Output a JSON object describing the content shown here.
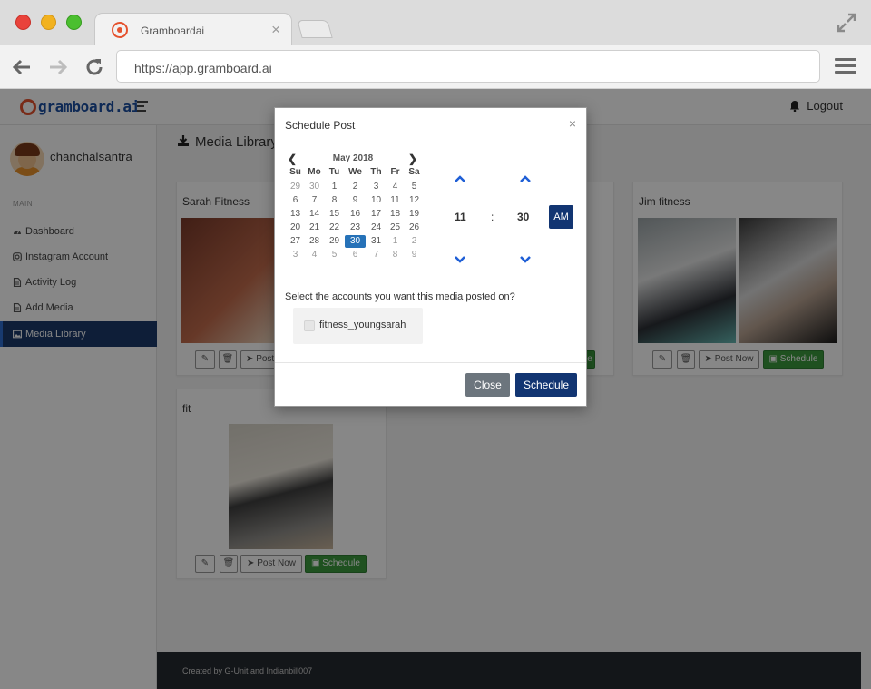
{
  "browser": {
    "tab_title": "Gramboardai",
    "url": "https://app.gramboard.ai"
  },
  "app": {
    "brand": "gramboard.ai",
    "logout_label": "Logout",
    "user": {
      "name": "chanchalsantra"
    },
    "sidebar": {
      "section_label": "MAIN",
      "items": [
        {
          "label": "Dashboard",
          "icon": "dashboard-icon"
        },
        {
          "label": "Instagram Account",
          "icon": "instagram-icon"
        },
        {
          "label": "Activity Log",
          "icon": "file-icon"
        },
        {
          "label": "Add Media",
          "icon": "file-icon"
        },
        {
          "label": "Media Library",
          "icon": "image-icon",
          "active": true
        }
      ]
    },
    "page_title": "Media Library",
    "cards": [
      {
        "title": "Sarah Fitness"
      },
      {
        "title": "Jim fitness"
      },
      {
        "title": "fit"
      }
    ],
    "card_actions": {
      "post_now": "Post Now",
      "schedule": "Schedule"
    },
    "footer": "Created by G-Unit and Indianbill007"
  },
  "modal": {
    "title": "Schedule Post",
    "close_x": "×",
    "calendar": {
      "month_label": "May 2018",
      "weekdays": [
        "Su",
        "Mo",
        "Tu",
        "We",
        "Th",
        "Fr",
        "Sa"
      ],
      "weeks": [
        [
          "29",
          "30",
          "1",
          "2",
          "3",
          "4",
          "5"
        ],
        [
          "6",
          "7",
          "8",
          "9",
          "10",
          "11",
          "12"
        ],
        [
          "13",
          "14",
          "15",
          "16",
          "17",
          "18",
          "19"
        ],
        [
          "20",
          "21",
          "22",
          "23",
          "24",
          "25",
          "26"
        ],
        [
          "27",
          "28",
          "29",
          "30",
          "31",
          "1",
          "2"
        ],
        [
          "3",
          "4",
          "5",
          "6",
          "7",
          "8",
          "9"
        ]
      ],
      "selected_day": "30"
    },
    "time": {
      "hour": "11",
      "separator": ":",
      "minute": "30",
      "meridiem": "AM"
    },
    "accounts_prompt": "Select the accounts you want this media posted on?",
    "accounts": [
      {
        "name": "fitness_youngsarah",
        "checked": false
      }
    ],
    "close_label": "Close",
    "schedule_label": "Schedule"
  },
  "colors": {
    "primary": "#123572",
    "sidebar_active": "#1b3a6b",
    "success": "#3b9a3d",
    "brand_orange": "#e5522e",
    "calendar_selected": "#2672b8"
  }
}
